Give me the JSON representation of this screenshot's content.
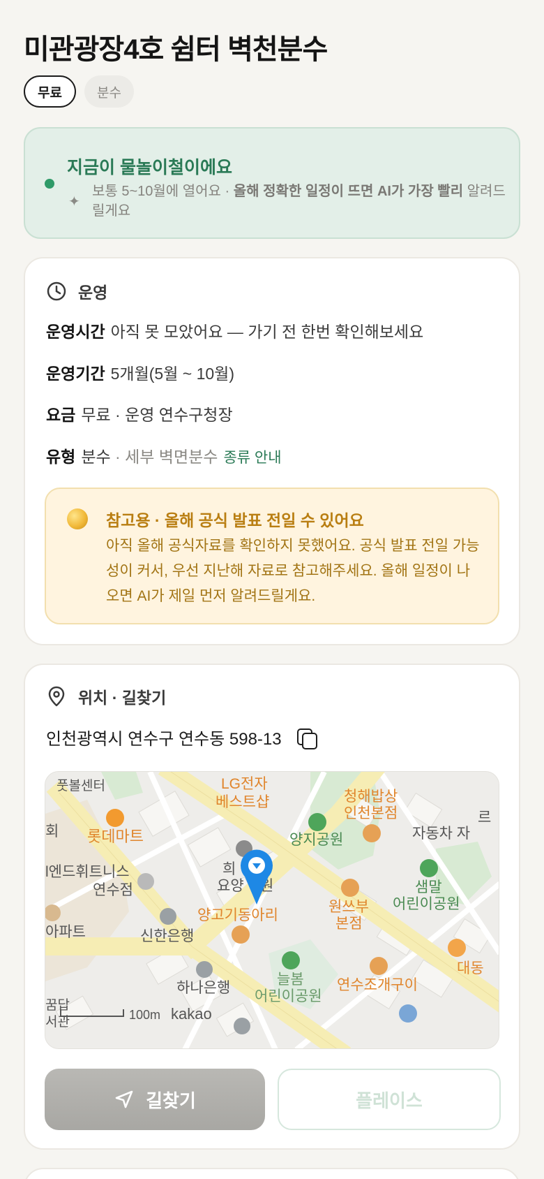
{
  "header": {
    "title": "미관광장4호 쉼터 벽천분수",
    "chips": [
      "무료",
      "분수"
    ]
  },
  "season": {
    "headline": "지금이 물놀이철이에요",
    "desc_prefix": "보통 5~10월에 열어요 · ",
    "desc_bold": "올해 정확한 일정이 뜨면 AI가 가장 빨리",
    "desc_suffix": " 알려드릴게요"
  },
  "ops": {
    "section_label": "운영",
    "hours_key": "운영시간",
    "hours_val": "아직 못 모았어요 — 가기 전 한번 확인해보세요",
    "period_key": "운영기간",
    "period_val": "5개월(5월 ~ 10월)",
    "fee_key": "요금",
    "fee_val": "무료 · 운영 연수구청장",
    "type_key": "유형",
    "type_val": "분수",
    "type_detail": " · 세부 벽면분수",
    "type_link": "종류 안내",
    "notice_title": "참고용 · 올해 공식 발표 전일 수 있어요",
    "notice_body": "아직 올해 공식자료를 확인하지 못했어요. 공식 발표 전일 가능성이 커서, 우선 지난해 자료로 참고해주세요. 올해 일정이 나오면 AI가 제일 먼저 알려드릴게요."
  },
  "location": {
    "section_label": "위치 · 길찾기",
    "address": "인천광역시 연수구 연수동 598-13",
    "map_labels": {
      "lg": "LG전자",
      "lg2": "베스트샵",
      "restaurant1": "청해밥상",
      "restaurant1b": "인천본점",
      "futsal": "풋볼센터",
      "lotte": "롯데마트",
      "park1": "양지공원",
      "car": "자동차 자",
      "hope": "희",
      "nursing": "요양",
      "nursing2": "원",
      "ent": "l엔드휘트니스",
      "ent2": "연수점",
      "goat": "양고기동아리",
      "shinhan": "신한은행",
      "apt": "아파트",
      "wonsbu": "원쓰부",
      "wonsbu2": "본점",
      "saemal": "샘말",
      "saemal2": "어린이공원",
      "hana": "하나은행",
      "neulbom": "늘봄",
      "neulbom2": "어린이공원",
      "clam": "연수조개구이",
      "daedong": "대동",
      "scale": "100m",
      "brand": "kakao",
      "dream": "꿈답",
      "hall": "서관",
      "hwe": "회"
    },
    "route_label": "길찾기",
    "place_label": "플레이스"
  },
  "colors": {
    "accent_green": "#2a7a56",
    "notice_gold": "#b97e12",
    "map_marker": "#1e88e5"
  }
}
